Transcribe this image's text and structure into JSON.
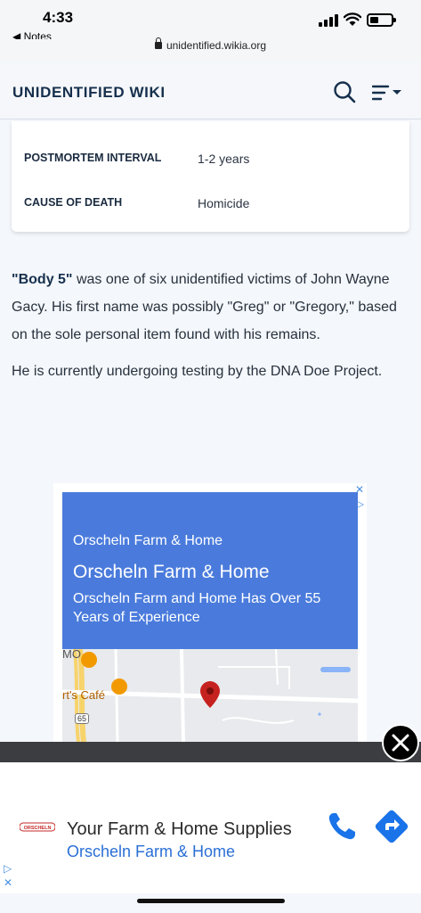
{
  "status_bar": {
    "time": "4:33",
    "back_label": "◀ Notes"
  },
  "browser": {
    "url": "unidentified.wikia.org"
  },
  "header": {
    "title": "UNIDENTIFIED WIKI"
  },
  "infobox": {
    "rows": [
      {
        "label": "POSTMORTEM INTERVAL",
        "value": "1-2 years"
      },
      {
        "label": "CAUSE OF DEATH",
        "value": "Homicide"
      }
    ]
  },
  "article": {
    "p1_bold": "\"Body 5\"",
    "p1_rest": " was one of six unidentified victims of John Wayne Gacy. His first name was possibly \"Greg\" or \"Gregory,\" based on the sole personal item found with his remains.",
    "p2": "He is currently undergoing testing by the DNA Doe Project."
  },
  "map_ad": {
    "advertiser_small": "Orscheln Farm & Home",
    "advertiser_big": "Orscheln Farm & Home",
    "description": "Orscheln Farm and Home Has Over 55 Years of Experience",
    "map_labels": {
      "place1": "MO",
      "place2": "rt's Café",
      "route": "65"
    },
    "close_glyph": "✕",
    "adchoice_glyph": "▷"
  },
  "bottom_ad": {
    "headline": "Your Farm & Home Supplies",
    "subline": "Orscheln Farm & Home",
    "logo_text": "ORSCHELN",
    "adchoice_glyph": "▷",
    "close_glyph": "✕"
  },
  "colors": {
    "header_text": "#16304d",
    "ad_blue": "#4a7bdc",
    "link_blue": "#2b6fd6"
  }
}
